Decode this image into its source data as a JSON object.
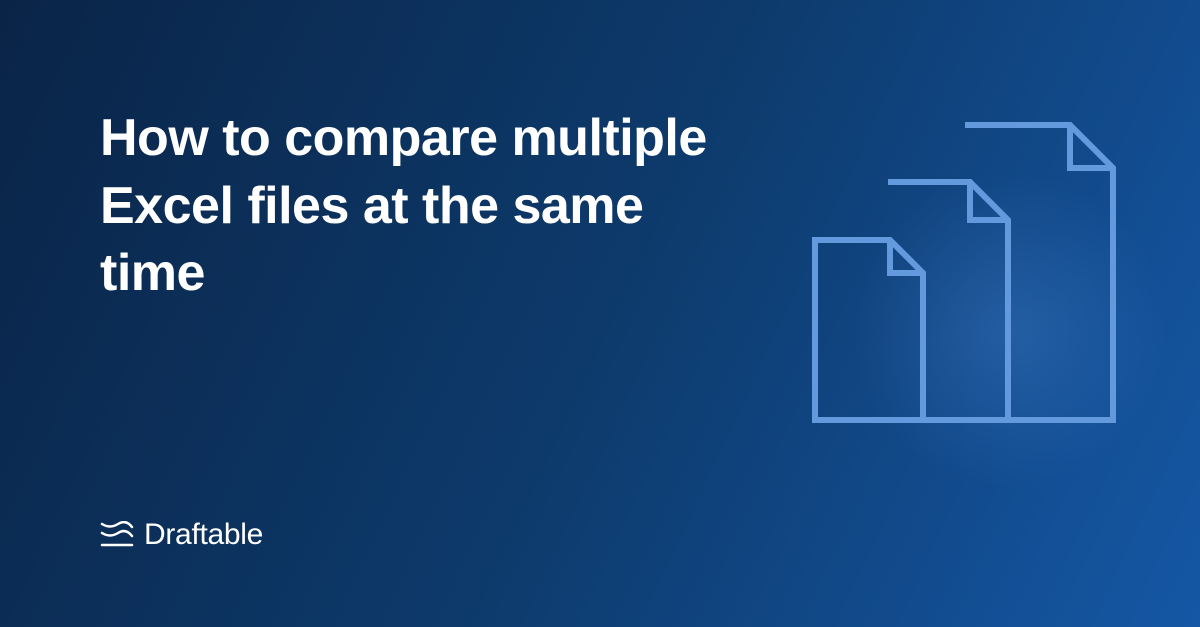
{
  "headline": "How to compare multiple Excel files at the same time",
  "brand": {
    "name": "Draftable"
  },
  "colors": {
    "text": "#ffffff",
    "iconStroke": "#6399dd",
    "bgGradientStart": "#0a2447",
    "bgGradientEnd": "#1557a5"
  }
}
